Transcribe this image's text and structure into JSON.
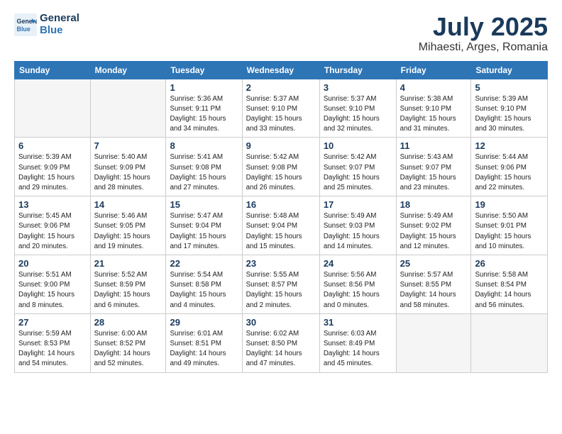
{
  "logo": {
    "line1": "General",
    "line2": "Blue"
  },
  "title": "July 2025",
  "subtitle": "Mihaesti, Arges, Romania",
  "headers": [
    "Sunday",
    "Monday",
    "Tuesday",
    "Wednesday",
    "Thursday",
    "Friday",
    "Saturday"
  ],
  "weeks": [
    [
      {
        "num": "",
        "info": ""
      },
      {
        "num": "",
        "info": ""
      },
      {
        "num": "1",
        "info": "Sunrise: 5:36 AM\nSunset: 9:11 PM\nDaylight: 15 hours\nand 34 minutes."
      },
      {
        "num": "2",
        "info": "Sunrise: 5:37 AM\nSunset: 9:10 PM\nDaylight: 15 hours\nand 33 minutes."
      },
      {
        "num": "3",
        "info": "Sunrise: 5:37 AM\nSunset: 9:10 PM\nDaylight: 15 hours\nand 32 minutes."
      },
      {
        "num": "4",
        "info": "Sunrise: 5:38 AM\nSunset: 9:10 PM\nDaylight: 15 hours\nand 31 minutes."
      },
      {
        "num": "5",
        "info": "Sunrise: 5:39 AM\nSunset: 9:10 PM\nDaylight: 15 hours\nand 30 minutes."
      }
    ],
    [
      {
        "num": "6",
        "info": "Sunrise: 5:39 AM\nSunset: 9:09 PM\nDaylight: 15 hours\nand 29 minutes."
      },
      {
        "num": "7",
        "info": "Sunrise: 5:40 AM\nSunset: 9:09 PM\nDaylight: 15 hours\nand 28 minutes."
      },
      {
        "num": "8",
        "info": "Sunrise: 5:41 AM\nSunset: 9:08 PM\nDaylight: 15 hours\nand 27 minutes."
      },
      {
        "num": "9",
        "info": "Sunrise: 5:42 AM\nSunset: 9:08 PM\nDaylight: 15 hours\nand 26 minutes."
      },
      {
        "num": "10",
        "info": "Sunrise: 5:42 AM\nSunset: 9:07 PM\nDaylight: 15 hours\nand 25 minutes."
      },
      {
        "num": "11",
        "info": "Sunrise: 5:43 AM\nSunset: 9:07 PM\nDaylight: 15 hours\nand 23 minutes."
      },
      {
        "num": "12",
        "info": "Sunrise: 5:44 AM\nSunset: 9:06 PM\nDaylight: 15 hours\nand 22 minutes."
      }
    ],
    [
      {
        "num": "13",
        "info": "Sunrise: 5:45 AM\nSunset: 9:06 PM\nDaylight: 15 hours\nand 20 minutes."
      },
      {
        "num": "14",
        "info": "Sunrise: 5:46 AM\nSunset: 9:05 PM\nDaylight: 15 hours\nand 19 minutes."
      },
      {
        "num": "15",
        "info": "Sunrise: 5:47 AM\nSunset: 9:04 PM\nDaylight: 15 hours\nand 17 minutes."
      },
      {
        "num": "16",
        "info": "Sunrise: 5:48 AM\nSunset: 9:04 PM\nDaylight: 15 hours\nand 15 minutes."
      },
      {
        "num": "17",
        "info": "Sunrise: 5:49 AM\nSunset: 9:03 PM\nDaylight: 15 hours\nand 14 minutes."
      },
      {
        "num": "18",
        "info": "Sunrise: 5:49 AM\nSunset: 9:02 PM\nDaylight: 15 hours\nand 12 minutes."
      },
      {
        "num": "19",
        "info": "Sunrise: 5:50 AM\nSunset: 9:01 PM\nDaylight: 15 hours\nand 10 minutes."
      }
    ],
    [
      {
        "num": "20",
        "info": "Sunrise: 5:51 AM\nSunset: 9:00 PM\nDaylight: 15 hours\nand 8 minutes."
      },
      {
        "num": "21",
        "info": "Sunrise: 5:52 AM\nSunset: 8:59 PM\nDaylight: 15 hours\nand 6 minutes."
      },
      {
        "num": "22",
        "info": "Sunrise: 5:54 AM\nSunset: 8:58 PM\nDaylight: 15 hours\nand 4 minutes."
      },
      {
        "num": "23",
        "info": "Sunrise: 5:55 AM\nSunset: 8:57 PM\nDaylight: 15 hours\nand 2 minutes."
      },
      {
        "num": "24",
        "info": "Sunrise: 5:56 AM\nSunset: 8:56 PM\nDaylight: 15 hours\nand 0 minutes."
      },
      {
        "num": "25",
        "info": "Sunrise: 5:57 AM\nSunset: 8:55 PM\nDaylight: 14 hours\nand 58 minutes."
      },
      {
        "num": "26",
        "info": "Sunrise: 5:58 AM\nSunset: 8:54 PM\nDaylight: 14 hours\nand 56 minutes."
      }
    ],
    [
      {
        "num": "27",
        "info": "Sunrise: 5:59 AM\nSunset: 8:53 PM\nDaylight: 14 hours\nand 54 minutes."
      },
      {
        "num": "28",
        "info": "Sunrise: 6:00 AM\nSunset: 8:52 PM\nDaylight: 14 hours\nand 52 minutes."
      },
      {
        "num": "29",
        "info": "Sunrise: 6:01 AM\nSunset: 8:51 PM\nDaylight: 14 hours\nand 49 minutes."
      },
      {
        "num": "30",
        "info": "Sunrise: 6:02 AM\nSunset: 8:50 PM\nDaylight: 14 hours\nand 47 minutes."
      },
      {
        "num": "31",
        "info": "Sunrise: 6:03 AM\nSunset: 8:49 PM\nDaylight: 14 hours\nand 45 minutes."
      },
      {
        "num": "",
        "info": ""
      },
      {
        "num": "",
        "info": ""
      }
    ]
  ]
}
